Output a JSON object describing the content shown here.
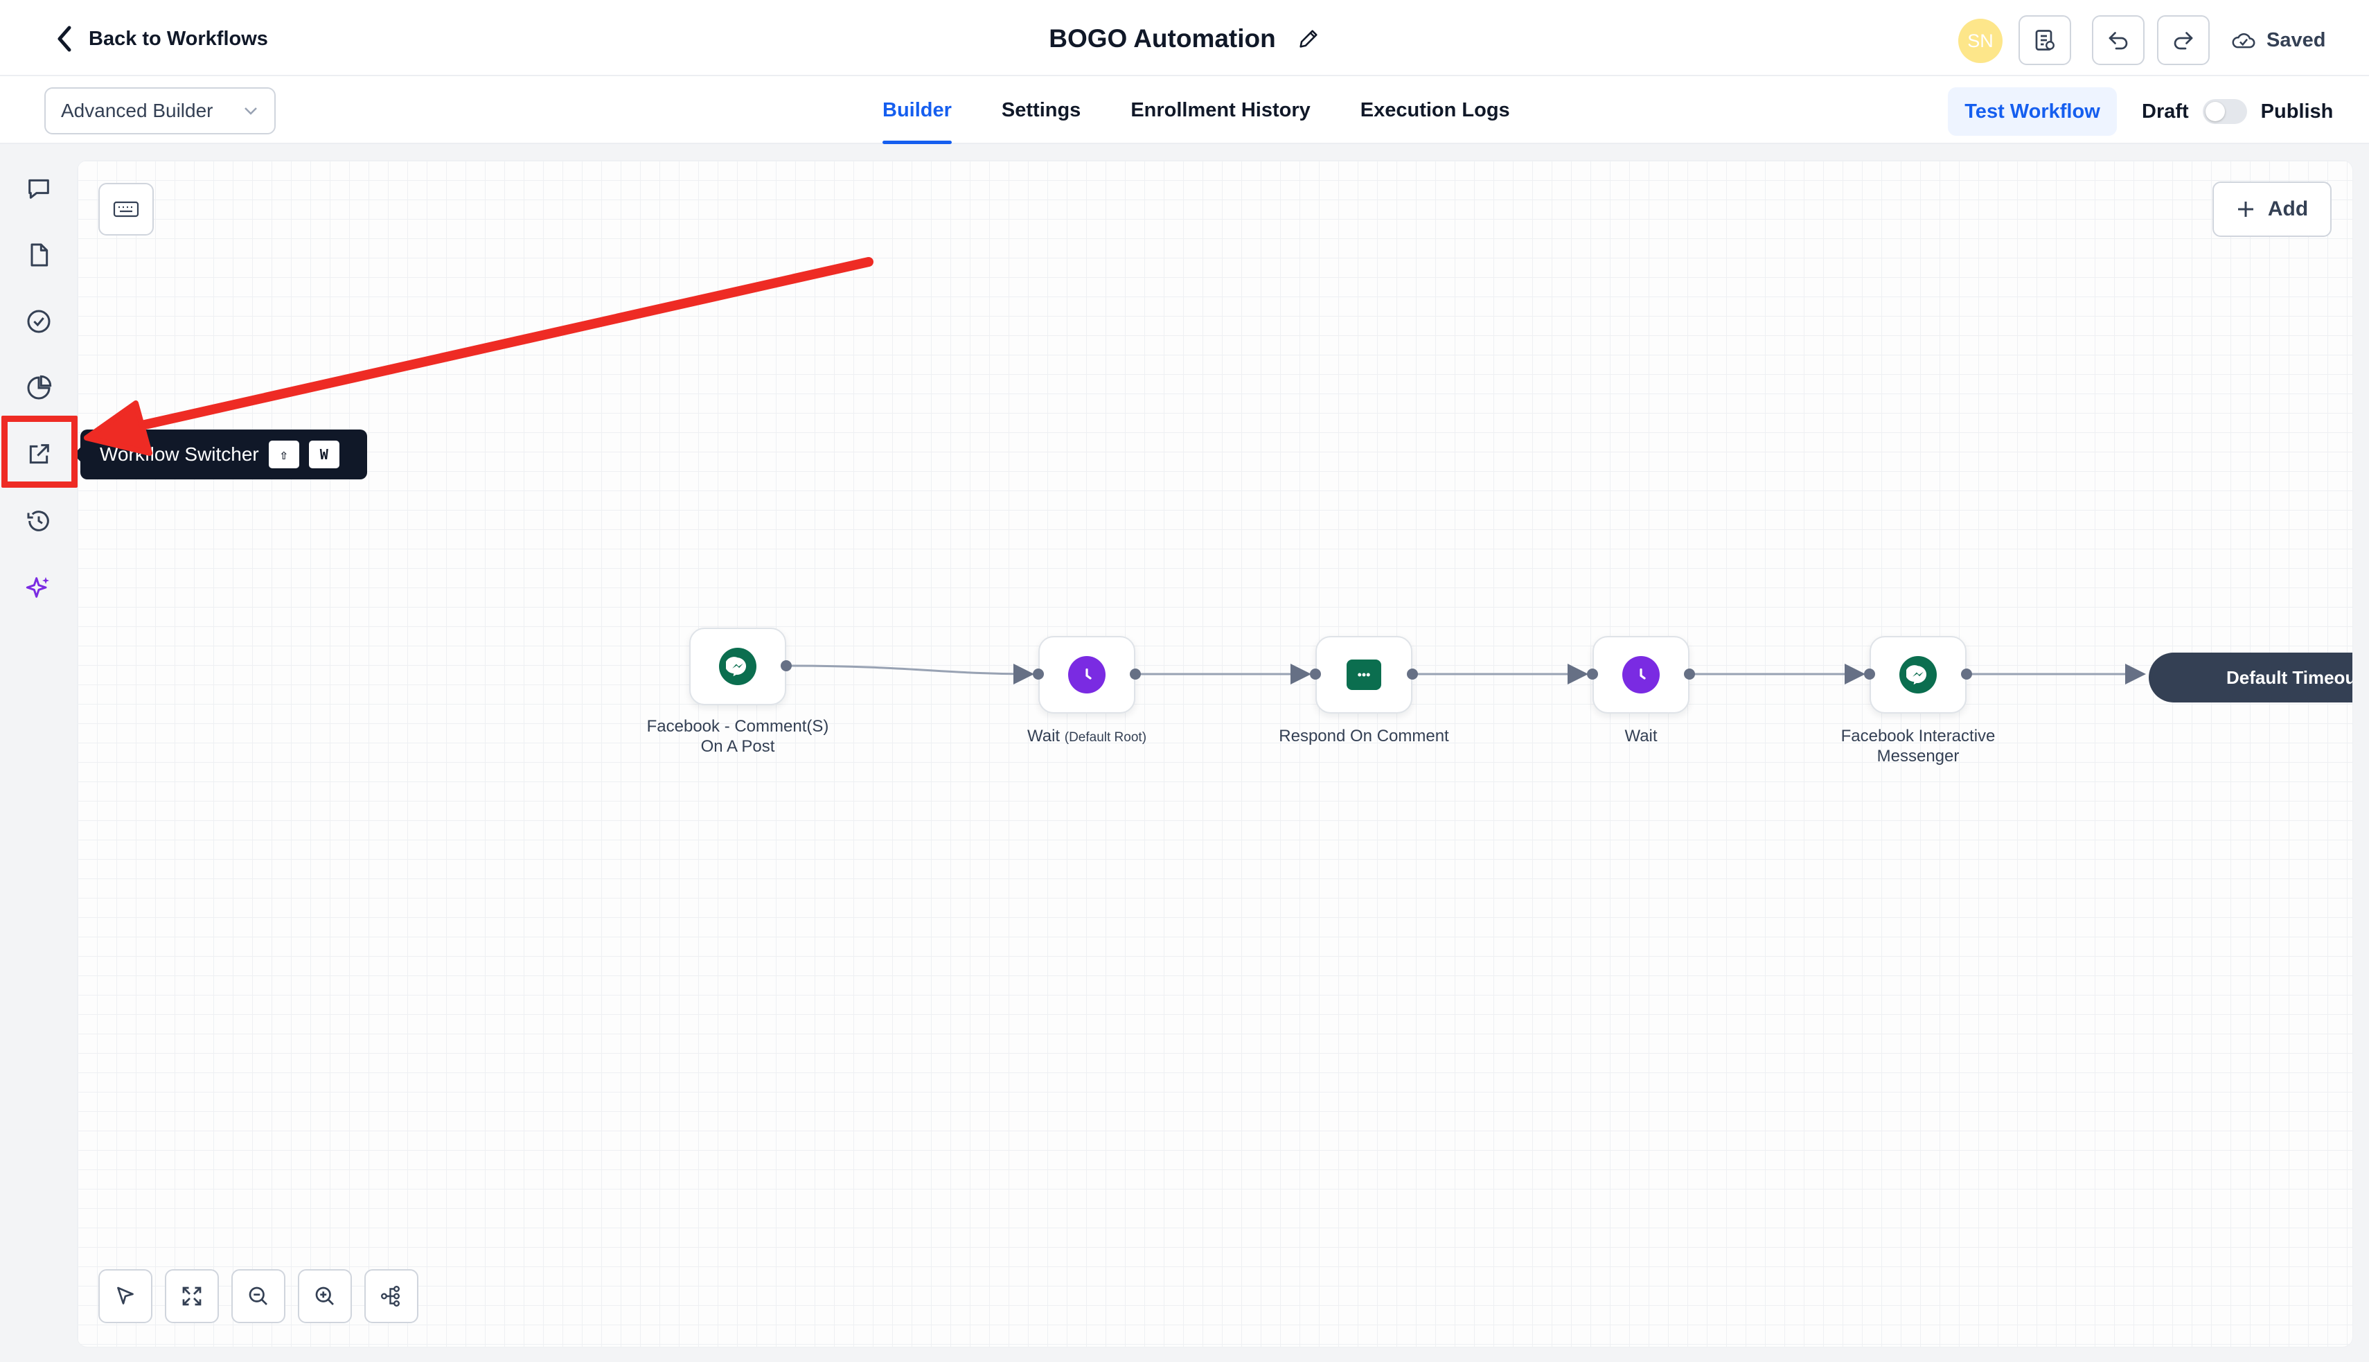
{
  "header": {
    "back_label": "Back to Workflows",
    "title": "BOGO Automation",
    "avatar_initials": "SN",
    "saved_label": "Saved"
  },
  "subheader": {
    "builder_mode": "Advanced Builder",
    "tabs": [
      {
        "label": "Builder",
        "active": true
      },
      {
        "label": "Settings",
        "active": false
      },
      {
        "label": "Enrollment History",
        "active": false
      },
      {
        "label": "Execution Logs",
        "active": false
      }
    ],
    "test_button": "Test Workflow",
    "draft_label": "Draft",
    "publish_label": "Publish"
  },
  "sidebar": {
    "icons": [
      "chat-icon",
      "document-icon",
      "check-circle-icon",
      "pie-chart-icon",
      "external-link-icon",
      "history-icon",
      "sparkles-icon"
    ]
  },
  "tooltip": {
    "label": "Workflow Switcher",
    "key1": "⇧",
    "key2": "W"
  },
  "canvas": {
    "add_label": "Add",
    "nodes": [
      {
        "label": "Facebook - Comment(S)",
        "label2": "On A Post",
        "icon": "messenger-icon",
        "color": "#0b6e4f"
      },
      {
        "label": "Wait",
        "sub": "(Default Root)",
        "icon": "clock-icon",
        "color": "#7a2be2"
      },
      {
        "label": "Respond On Comment",
        "icon": "message-dots-icon",
        "color": "#0b6e4f"
      },
      {
        "label": "Wait",
        "icon": "clock-icon",
        "color": "#7a2be2"
      },
      {
        "label": "Facebook Interactive",
        "label2": "Messenger",
        "icon": "messenger-icon",
        "color": "#0b6e4f"
      }
    ],
    "timeout_label": "Default Timeout"
  },
  "colors": {
    "accent": "#155eef",
    "annotation_red": "#ee2b24",
    "node_green": "#0b6e4f",
    "node_purple": "#7a2be2"
  }
}
